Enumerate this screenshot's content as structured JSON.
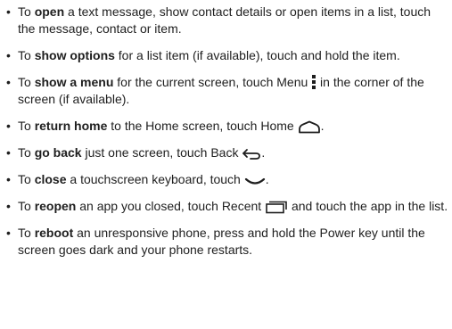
{
  "items": [
    {
      "pre": "To ",
      "bold": "open",
      "post": " a text message, show contact details or open items in a list, touch the message, contact or item."
    },
    {
      "pre": "To ",
      "bold": "show options",
      "post": " for a list item (if available), touch and hold the item."
    },
    {
      "pre": "To ",
      "bold": "show a menu",
      "mid": " for the current screen, touch Menu",
      "icon": "menu-dots-icon",
      "post": " in the corner of the screen (if available)."
    },
    {
      "pre": "To ",
      "bold": "return home",
      "mid": " to the Home screen, touch Home",
      "icon": "home-icon",
      "post": "."
    },
    {
      "pre": "To ",
      "bold": "go back",
      "mid": " just one screen, touch Back",
      "icon": "back-arrow-icon",
      "post": "."
    },
    {
      "pre": "To ",
      "bold": "close",
      "mid": " a touchscreen keyboard, touch",
      "icon": "keyboard-hide-chevron-icon",
      "post": "."
    },
    {
      "pre": "To ",
      "bold": "reopen",
      "mid": " an app you closed, touch Recent",
      "icon": "recent-apps-icon",
      "post": " and touch the app in the list."
    },
    {
      "pre": "To ",
      "bold": "reboot",
      "post": " an unresponsive phone, press and hold the Power key until the screen goes dark and your phone restarts."
    }
  ],
  "bullet": "•",
  "colors": {
    "text": "#1e1e1e",
    "background": "#ffffff"
  }
}
